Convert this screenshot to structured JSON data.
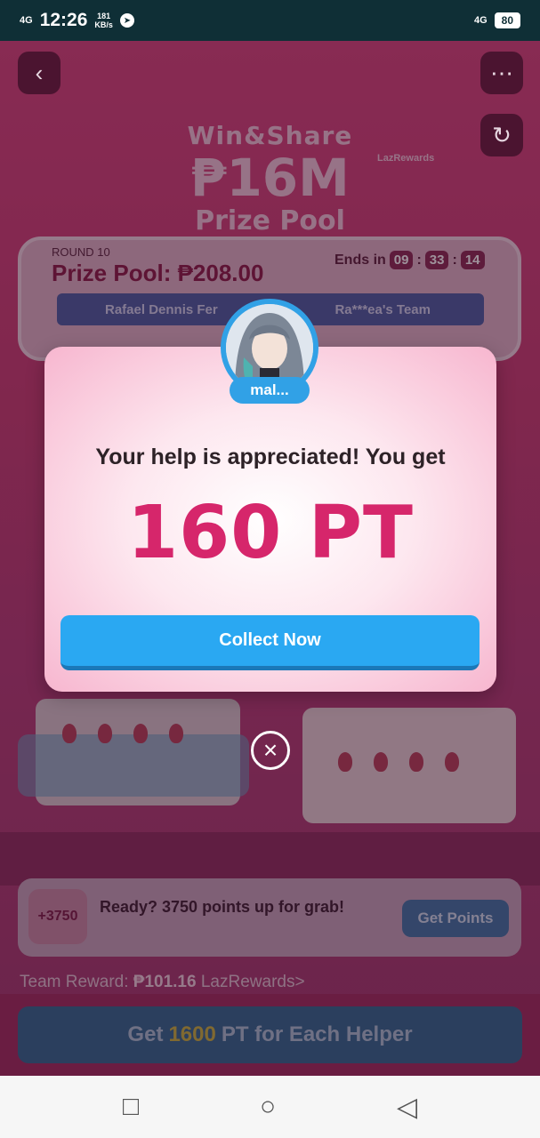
{
  "status_bar": {
    "network": "4G",
    "time": "12:26",
    "speed_top": "181",
    "speed_bottom": "KB/s",
    "network_right": "4G",
    "battery": "80"
  },
  "header": {
    "hero_line1": "Win&Share",
    "hero_line2": "₱16M",
    "hero_line3": "Prize Pool",
    "brand": "LazRewards"
  },
  "round": {
    "label": "ROUND 10",
    "prize_label": "Prize Pool: ₱208.00",
    "ends_label": "Ends in",
    "timer": [
      "09",
      "33",
      "14"
    ],
    "left_team": "Rafael Dennis Fer",
    "right_team": "Ra***ea's Team"
  },
  "modal": {
    "avatar_name": "mal...",
    "message": "Your help is appreciated! You get",
    "points": "160 PT",
    "collect_label": "Collect Now"
  },
  "ready_card": {
    "badge": "+3750",
    "text": "Ready? 3750 points up for grab!",
    "button": "Get Points"
  },
  "team_reward": {
    "label": "Team Reward:",
    "amount": "₱101.16",
    "brand": "LazRewards>"
  },
  "cta": {
    "prefix": "Get",
    "highlight": "1600",
    "suffix": "PT for Each Helper"
  },
  "colors": {
    "accent_pink": "#d6266b",
    "button_blue": "#2aa8f2"
  }
}
